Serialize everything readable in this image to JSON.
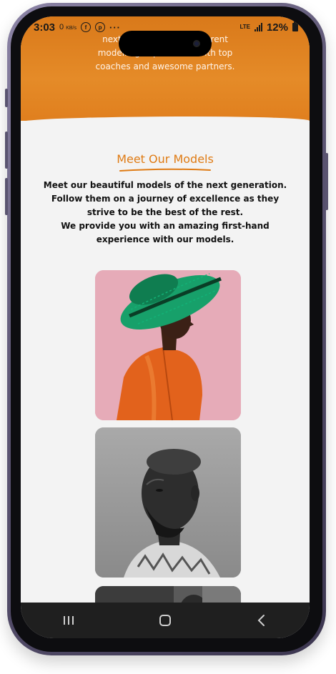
{
  "status_bar": {
    "time": "3:03",
    "speed_value": "0",
    "speed_unit": "KB/s",
    "app_icons": [
      "facebook-icon",
      "pinterest-icon"
    ],
    "more_indicator": "···",
    "network": "LTE",
    "battery": "12%"
  },
  "banner": {
    "text": "next ... and experi... different modelling experiences with top coaches and awesome partners.",
    "color": "#e0821f"
  },
  "section": {
    "heading": "Meet Our Models",
    "description": "Meet our beautiful models of the next generation. Follow them on a journey of excellence as they strive to be the best of the rest.",
    "description2": "We provide you with an amazing first-hand experience with our models.",
    "accent_color": "#df7b14"
  },
  "models": [
    {
      "alt": "Model in green woven hat and orange jacket"
    },
    {
      "alt": "Black and white portrait of male model"
    },
    {
      "alt": "Third model portrait"
    }
  ],
  "nav_bar": {
    "buttons": [
      "recents-button",
      "home-button",
      "back-button"
    ]
  }
}
